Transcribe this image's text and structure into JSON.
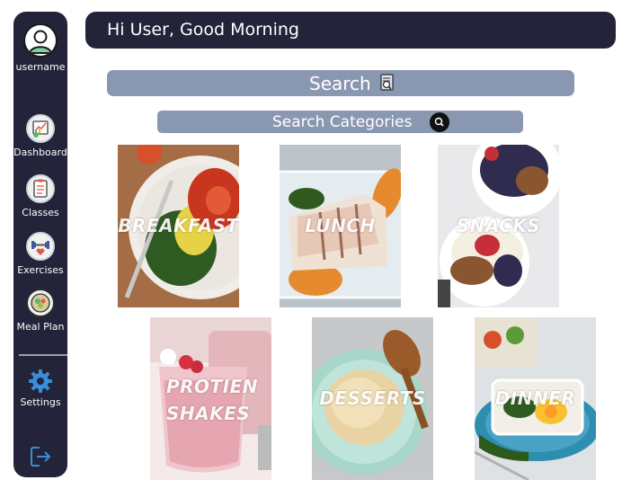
{
  "sidebar": {
    "username": "username",
    "items": [
      {
        "label": "Dashboard",
        "icon": "dashboard-chart-icon"
      },
      {
        "label": "Classes",
        "icon": "clipboard-checklist-icon"
      },
      {
        "label": "Exercises",
        "icon": "dumbbell-heart-icon"
      },
      {
        "label": "Meal Plan",
        "icon": "salad-bowl-icon"
      }
    ],
    "settings_label": "Settings",
    "logout_icon": "logout-icon"
  },
  "header": {
    "greeting": "Hi User, Good Morning"
  },
  "search": {
    "label": "Search",
    "icon": "search-document-icon"
  },
  "categories_search": {
    "label": "Search Categories",
    "icon": "magnifier-icon"
  },
  "categories": [
    {
      "label": "BREAKFAST"
    },
    {
      "label": "LUNCH"
    },
    {
      "label": "SNACKS"
    },
    {
      "label": "PROTIEN\nSHAKES"
    },
    {
      "label": "DESSERTS"
    },
    {
      "label": "DINNER"
    }
  ],
  "colors": {
    "navy": "#23233a",
    "slate": "#8a97b1",
    "white": "#ffffff"
  }
}
